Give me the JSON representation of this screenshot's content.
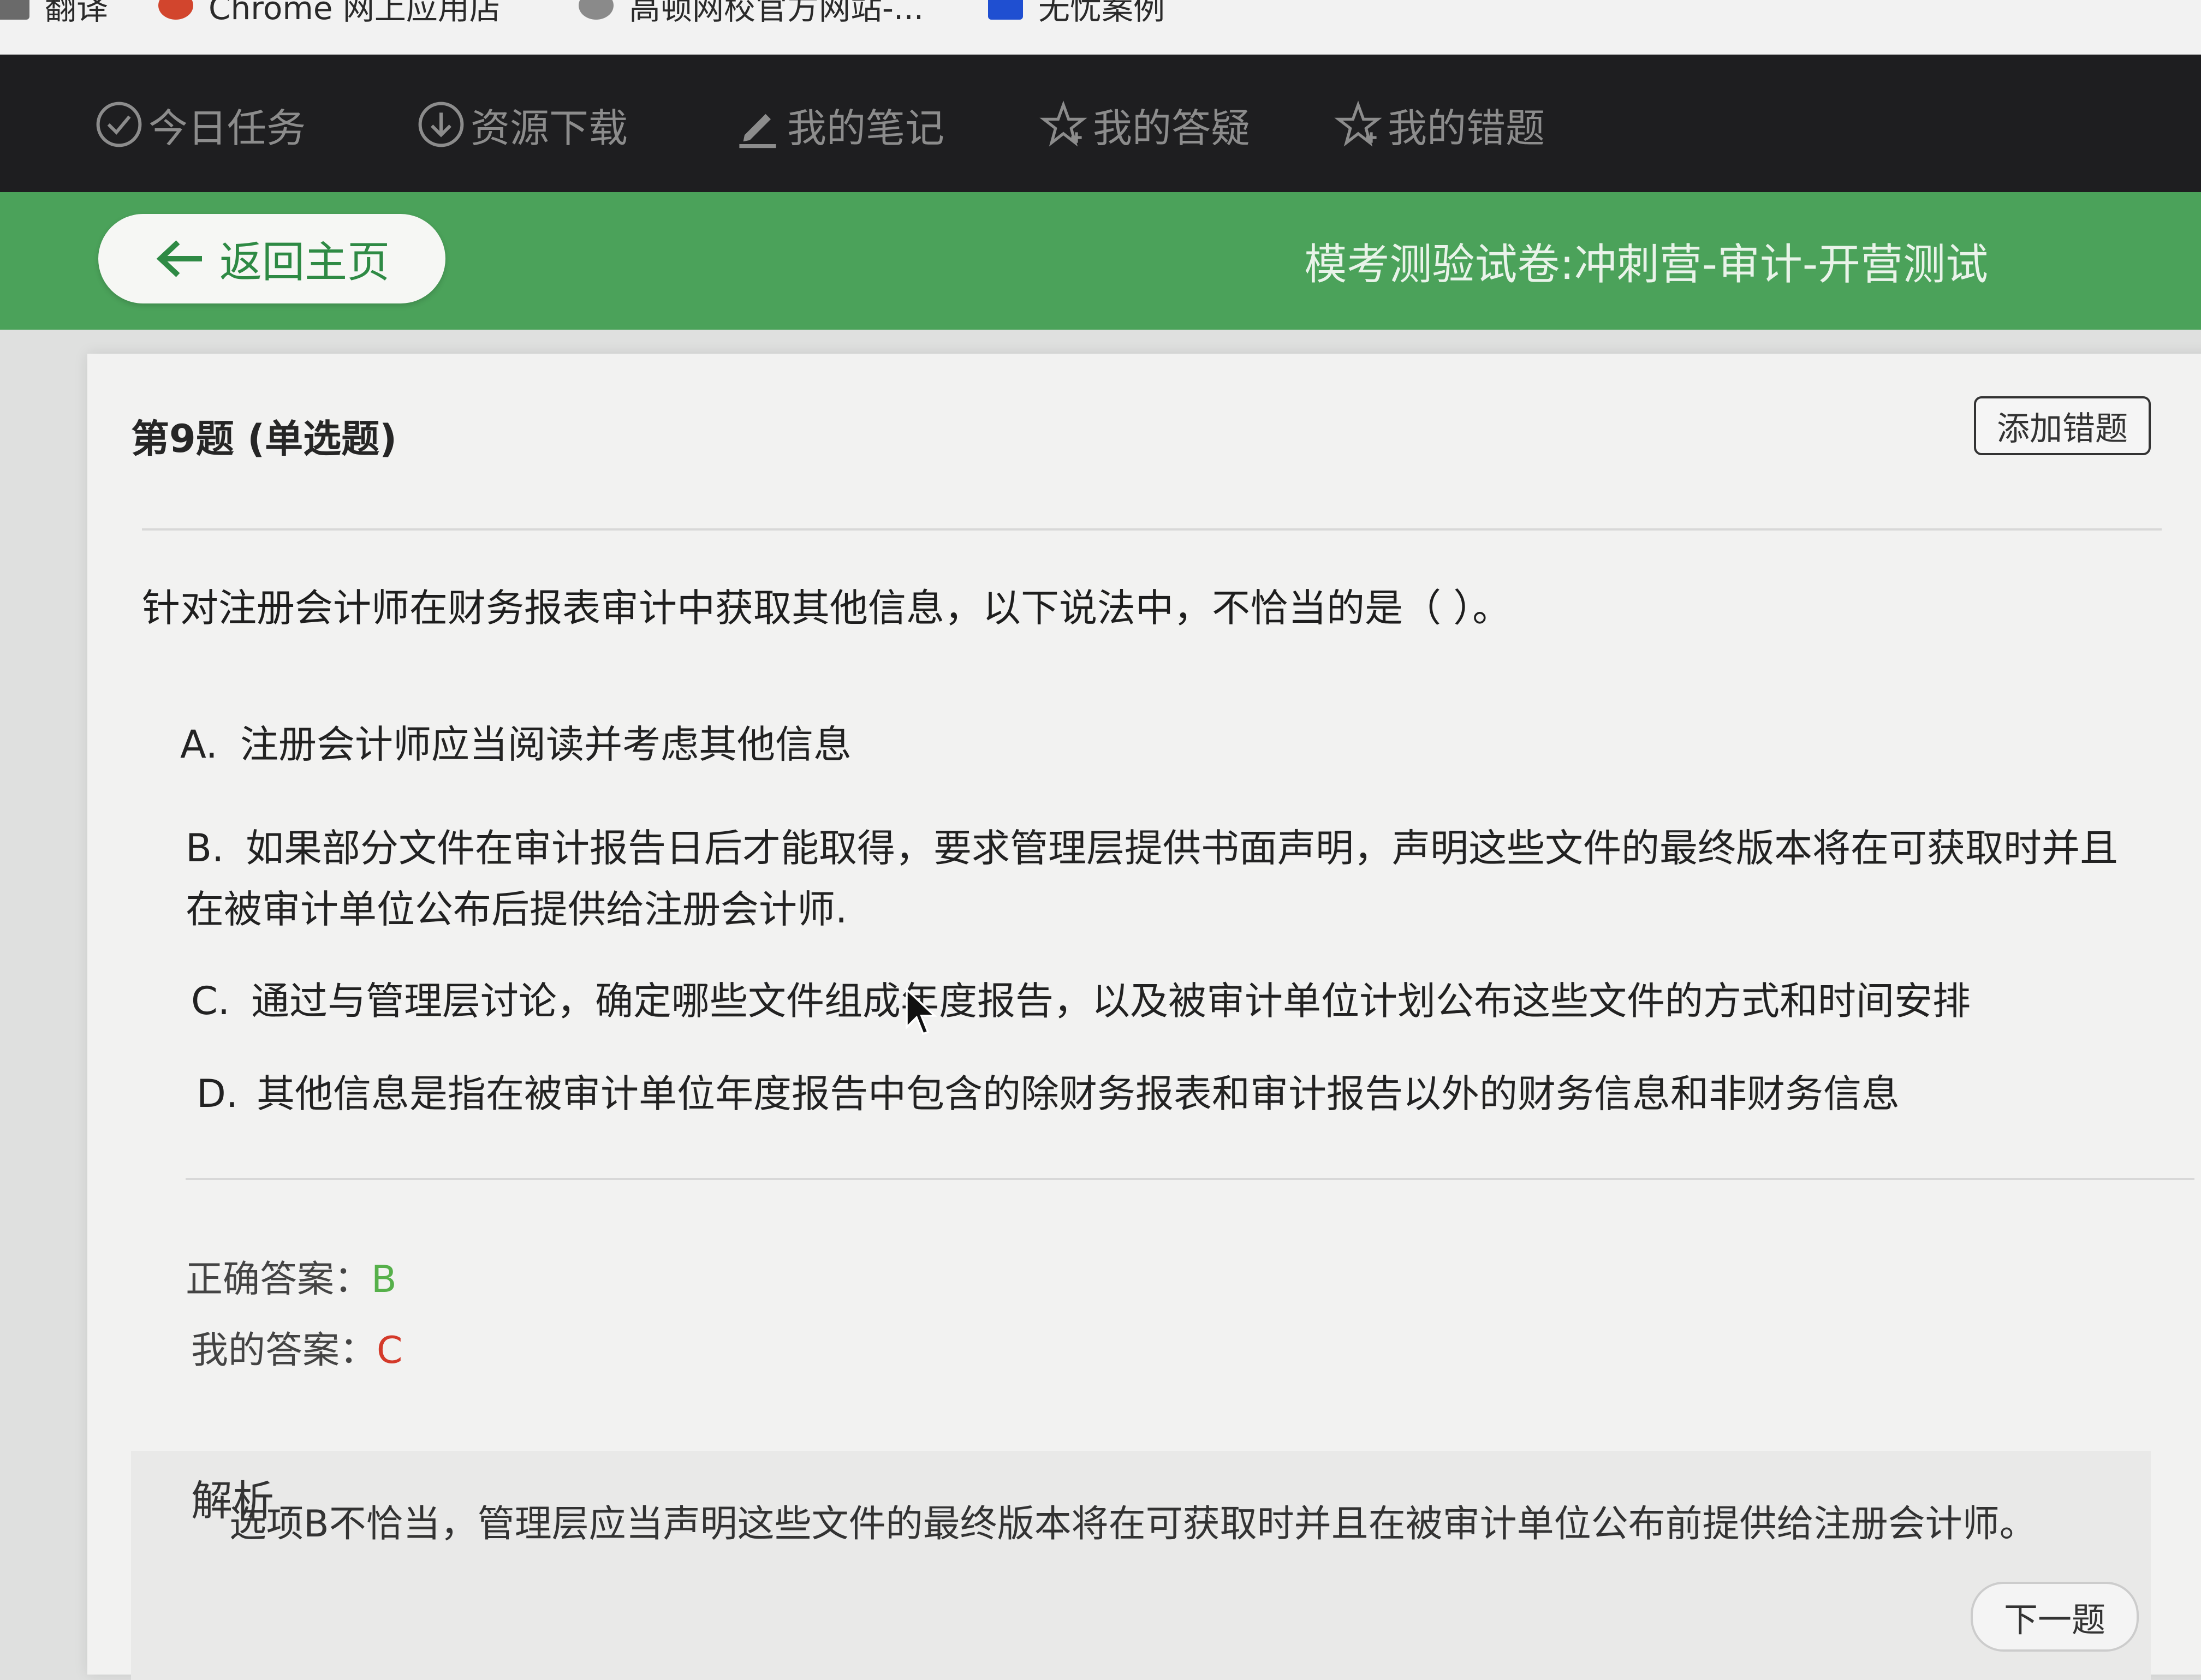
{
  "bookmarks": [
    {
      "label": "翻译",
      "icon": "folder-icon"
    },
    {
      "label": "Chrome 网上应用店",
      "icon": "chrome-store-icon"
    },
    {
      "label": "高顿网校官方网站-...",
      "icon": "gaodun-logo-icon"
    },
    {
      "label": "无忧案例",
      "icon": "blue-square-icon"
    }
  ],
  "topnav": {
    "items": [
      {
        "label": "今日任务",
        "icon": "check-circle-icon"
      },
      {
        "label": "资源下载",
        "icon": "download-circle-icon"
      },
      {
        "label": "我的笔记",
        "icon": "pencil-icon"
      },
      {
        "label": "我的答疑",
        "icon": "star-plus-icon"
      },
      {
        "label": "我的错题",
        "icon": "star-plus-icon"
      }
    ]
  },
  "header": {
    "back_label": "返回主页",
    "exam_title": "模考测验试卷:冲刺营-审计-开营测试"
  },
  "question": {
    "number_label": "第9题 (单选题)",
    "add_wrong_label": "添加错题",
    "text": "针对注册会计师在财务报表审计中获取其他信息，以下说法中，不恰当的是（ ）。",
    "options": [
      {
        "letter": "A.",
        "text": "注册会计师应当阅读并考虑其他信息"
      },
      {
        "letter": "B.",
        "text": "如果部分文件在审计报告日后才能取得，要求管理层提供书面声明，声明这些文件的最终版本将在可获取时并且在被审计单位公布后提供给注册会计师."
      },
      {
        "letter": "C.",
        "text": "通过与管理层讨论，确定哪些文件组成年度报告，以及被审计单位计划公布这些文件的方式和时间安排"
      },
      {
        "letter": "D.",
        "text": "其他信息是指在被审计单位年度报告中包含的除财务报表和审计报告以外的财务信息和非财务信息"
      }
    ],
    "correct_label": "正确答案：",
    "correct_value": "B",
    "mine_label": "我的答案：",
    "mine_value": "C"
  },
  "analysis": {
    "title": "解析",
    "text": "选项B不恰当，管理层应当声明这些文件的最终版本将在可获取时并且在被审计单位公布前提供给注册会计师。"
  },
  "footer": {
    "next_label": "下一题"
  },
  "colors": {
    "nav_bg": "#1e1e20",
    "header_green": "#4ba25a",
    "correct_green": "#56b04a",
    "wrong_red": "#d43a2a"
  }
}
